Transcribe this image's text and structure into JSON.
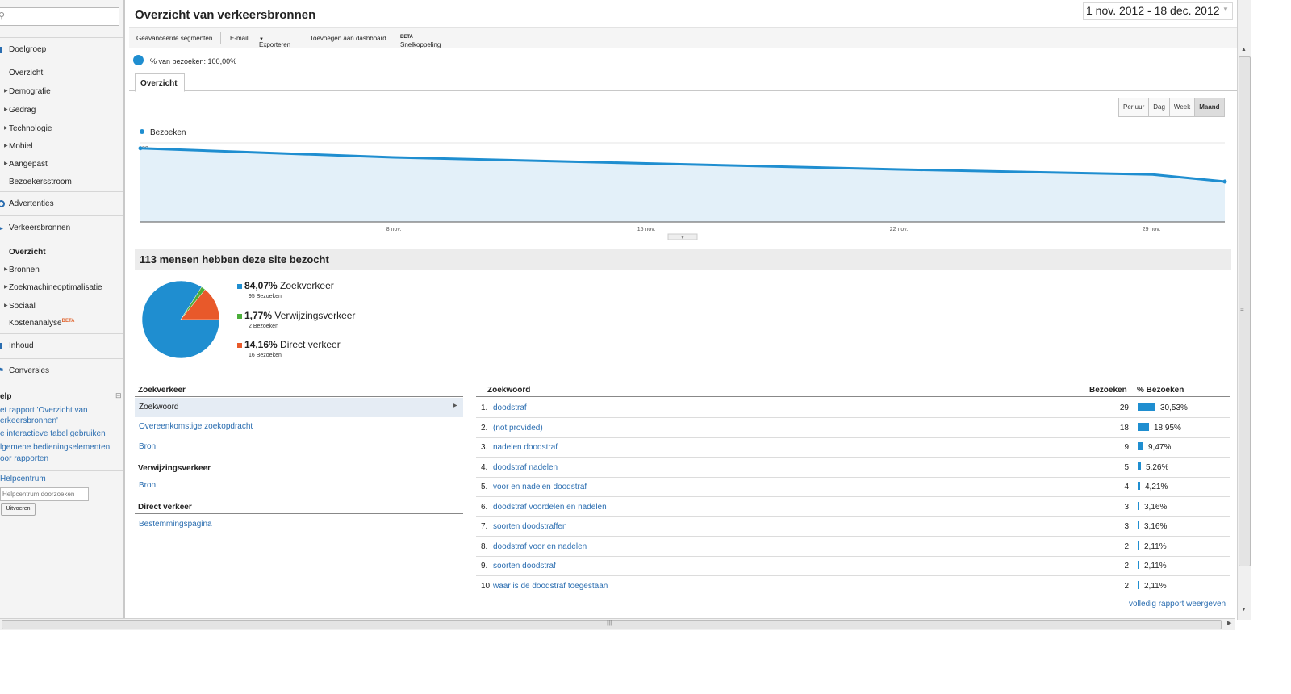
{
  "sidebar": {
    "search_placeholder": "",
    "sections": {
      "doelgroep": "Doelgroep",
      "advertenties": "Advertenties",
      "verkeersbronnen": "Verkeersbronnen",
      "inhoud": "Inhoud",
      "conversies": "Conversies"
    },
    "doelgroep_items": [
      "Overzicht",
      "Demografie",
      "Gedrag",
      "Technologie",
      "Mobiel",
      "Aangepast",
      "Bezoekersstroom"
    ],
    "verkeer_items": [
      "Overzicht",
      "Bronnen",
      "Zoekmachineoptimalisatie",
      "Sociaal",
      "Kostenanalyse"
    ],
    "beta": "BETA",
    "help": {
      "title": "elp",
      "links": [
        "et rapport 'Overzicht van",
        "erkeersbronnen'",
        "e interactieve tabel gebruiken",
        "lgemene bedieningselementen",
        "oor rapporten"
      ],
      "helpcentrum": "Helpcentrum",
      "search_placeholder": "Helpcentrum doorzoeken",
      "execute": "Uitvoeren"
    }
  },
  "header": {
    "title": "Overzicht van verkeersbronnen",
    "date_range": "1 nov. 2012 - 18 dec. 2012"
  },
  "toolbar": {
    "segments": "Geavanceerde segmenten",
    "email": "E-mail",
    "export": "Exporteren",
    "dashboard": "Toevoegen aan dashboard",
    "shortcut": "Snelkoppeling",
    "beta": "BETA"
  },
  "segment_label": "% van bezoeken: 100,00%",
  "tabs": {
    "overview": "Overzicht"
  },
  "periods": [
    "Per uur",
    "Dag",
    "Week",
    "Maand"
  ],
  "active_period": "Maand",
  "colors": {
    "accent": "#1f8ed0",
    "orange": "#e8592a",
    "green": "#4cae3a"
  },
  "chart_data": {
    "type": "area",
    "series": [
      {
        "name": "Bezoeken",
        "values": [
          81,
          72,
          66,
          60,
          55,
          48
        ]
      }
    ],
    "x": [
      1,
      8,
      15,
      22,
      29,
      31
    ],
    "xticks": [
      "8 nov.",
      "15 nov.",
      "22 nov.",
      "29 nov."
    ],
    "yticks": [
      "80",
      "40"
    ],
    "ylim": [
      0,
      160
    ],
    "legend": "top-left"
  },
  "summary": {
    "headline": "113 mensen hebben deze site bezocht",
    "slices": [
      {
        "pct": "84,07%",
        "label": "Zoekverkeer",
        "sub": "95 Bezoeken",
        "value": 84.07,
        "color": "#1f8ed0"
      },
      {
        "pct": "1,77%",
        "label": "Verwijzingsverkeer",
        "sub": "2 Bezoeken",
        "value": 1.77,
        "color": "#4cae3a"
      },
      {
        "pct": "14,16%",
        "label": "Direct verkeer",
        "sub": "16 Bezoeken",
        "value": 14.16,
        "color": "#e8592a"
      }
    ]
  },
  "left_table": {
    "search_title": "Zoekverkeer",
    "search_items": [
      "Zoekwoord",
      "Overeenkomstige zoekopdracht",
      "Bron"
    ],
    "referral_title": "Verwijzingsverkeer",
    "referral_items": [
      "Bron"
    ],
    "direct_title": "Direct verkeer",
    "direct_items": [
      "Bestemmingspagina"
    ]
  },
  "right_table": {
    "col_keyword": "Zoekwoord",
    "col_visits": "Bezoeken",
    "col_pct": "% Bezoeken",
    "rows": [
      {
        "n": "1.",
        "kw": "doodstraf",
        "v": "29",
        "pct": "30,53%",
        "frac": 30.53
      },
      {
        "n": "2.",
        "kw": "(not provided)",
        "v": "18",
        "pct": "18,95%",
        "frac": 18.95
      },
      {
        "n": "3.",
        "kw": "nadelen doodstraf",
        "v": "9",
        "pct": "9,47%",
        "frac": 9.47
      },
      {
        "n": "4.",
        "kw": "doodstraf nadelen",
        "v": "5",
        "pct": "5,26%",
        "frac": 5.26
      },
      {
        "n": "5.",
        "kw": "voor en nadelen doodstraf",
        "v": "4",
        "pct": "4,21%",
        "frac": 4.21
      },
      {
        "n": "6.",
        "kw": "doodstraf voordelen en nadelen",
        "v": "3",
        "pct": "3,16%",
        "frac": 3.16
      },
      {
        "n": "7.",
        "kw": "soorten doodstraffen",
        "v": "3",
        "pct": "3,16%",
        "frac": 3.16
      },
      {
        "n": "8.",
        "kw": "doodstraf voor en nadelen",
        "v": "2",
        "pct": "2,11%",
        "frac": 2.11
      },
      {
        "n": "9.",
        "kw": "soorten doodstraf",
        "v": "2",
        "pct": "2,11%",
        "frac": 2.11
      },
      {
        "n": "10.",
        "kw": "waar is de doodstraf toegestaan",
        "v": "2",
        "pct": "2,11%",
        "frac": 2.11
      }
    ],
    "full_report": "volledig rapport weergeven"
  }
}
